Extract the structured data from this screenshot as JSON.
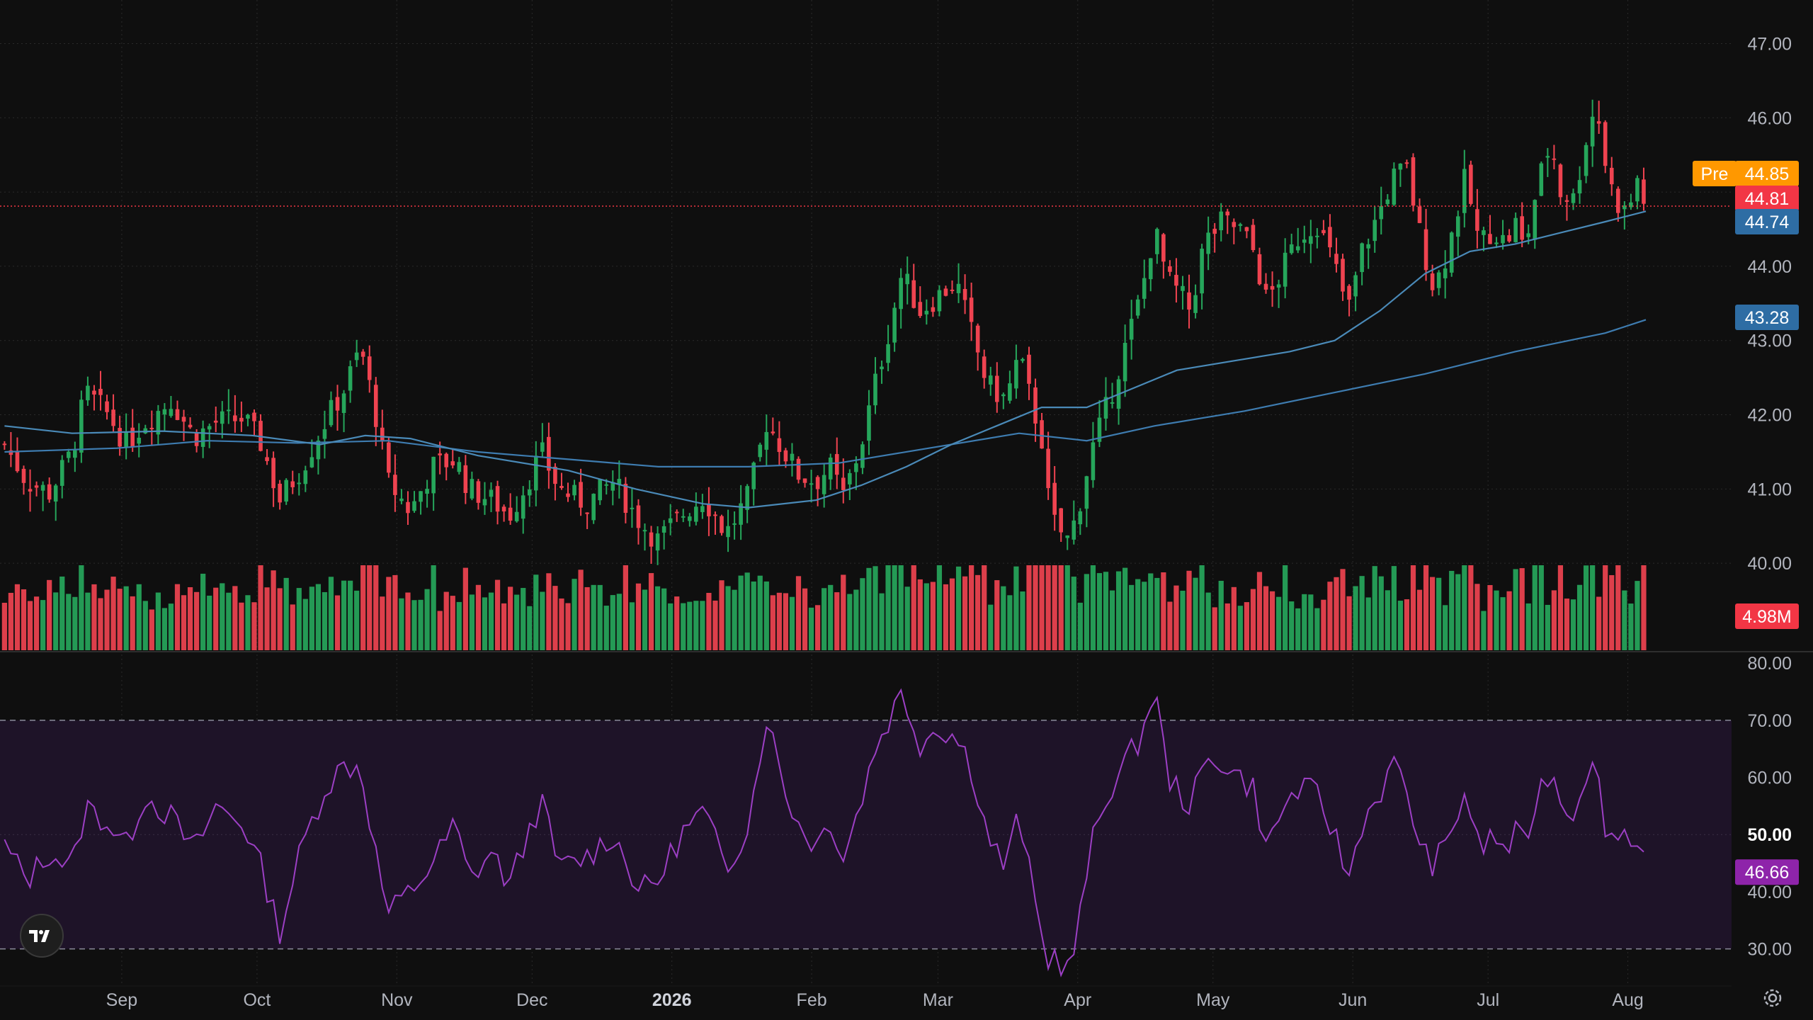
{
  "chart_data": {
    "type": "candlestick",
    "price_axis": {
      "ticks": [
        "47.00",
        "46.00",
        "45.00",
        "44.00",
        "43.00",
        "42.00",
        "41.00",
        "40.00"
      ],
      "range": [
        39.0,
        47.3
      ]
    },
    "time_axis": {
      "labels": [
        {
          "text": "Sep",
          "day": 11,
          "bold": false
        },
        {
          "text": "Oct",
          "day": 41,
          "bold": false
        },
        {
          "text": "Nov",
          "day": 72,
          "bold": false
        },
        {
          "text": "Dec",
          "day": 102,
          "bold": false
        },
        {
          "text": "2026",
          "day": 133,
          "bold": true
        },
        {
          "text": "Feb",
          "day": 164,
          "bold": false
        },
        {
          "text": "Mar",
          "day": 192,
          "bold": false
        },
        {
          "text": "Apr",
          "day": 223,
          "bold": false
        },
        {
          "text": "May",
          "day": 253,
          "bold": false
        },
        {
          "text": "Jun",
          "day": 284,
          "bold": false
        },
        {
          "text": "Jul",
          "day": 314,
          "bold": false
        },
        {
          "text": "Aug",
          "day": 345,
          "bold": false
        }
      ],
      "day_range": [
        -16,
        368
      ]
    },
    "price_path": [
      [
        -15,
        41.6
      ],
      [
        -10,
        41.1
      ],
      [
        -5,
        40.95
      ],
      [
        0,
        41.5
      ],
      [
        3,
        42.3
      ],
      [
        8,
        42.0
      ],
      [
        12,
        41.6
      ],
      [
        16,
        41.9
      ],
      [
        22,
        42.2
      ],
      [
        27,
        41.7
      ],
      [
        32,
        41.9
      ],
      [
        38,
        41.95
      ],
      [
        42,
        41.6
      ],
      [
        46,
        40.85
      ],
      [
        51,
        41.3
      ],
      [
        56,
        41.9
      ],
      [
        60,
        42.3
      ],
      [
        64,
        42.9
      ],
      [
        67,
        42.1
      ],
      [
        70,
        41.1
      ],
      [
        75,
        40.7
      ],
      [
        80,
        41.3
      ],
      [
        85,
        41.4
      ],
      [
        88,
        41.0
      ],
      [
        93,
        40.85
      ],
      [
        97,
        40.65
      ],
      [
        101,
        41.1
      ],
      [
        104,
        41.5
      ],
      [
        108,
        41.0
      ],
      [
        114,
        40.8
      ],
      [
        120,
        41.1
      ],
      [
        126,
        40.55
      ],
      [
        130,
        40.3
      ],
      [
        135,
        40.65
      ],
      [
        140,
        40.9
      ],
      [
        145,
        40.4
      ],
      [
        150,
        40.9
      ],
      [
        154,
        41.9
      ],
      [
        158,
        41.5
      ],
      [
        161,
        41.2
      ],
      [
        165,
        41.1
      ],
      [
        168,
        41.3
      ],
      [
        171,
        40.9
      ],
      [
        175,
        41.6
      ],
      [
        178,
        42.4
      ],
      [
        181,
        43.1
      ],
      [
        184,
        43.9
      ],
      [
        188,
        43.4
      ],
      [
        192,
        43.6
      ],
      [
        196,
        43.8
      ],
      [
        199,
        43.2
      ],
      [
        203,
        42.4
      ],
      [
        207,
        42.2
      ],
      [
        210,
        42.8
      ],
      [
        213,
        42.1
      ],
      [
        215,
        41.7
      ],
      [
        216,
        41.0
      ],
      [
        218,
        40.5
      ],
      [
        221,
        40.3
      ],
      [
        223,
        40.7
      ],
      [
        226,
        41.5
      ],
      [
        230,
        42.2
      ],
      [
        234,
        43.0
      ],
      [
        237,
        43.6
      ],
      [
        240,
        44.5
      ],
      [
        243,
        43.8
      ],
      [
        246,
        43.6
      ],
      [
        248,
        43.4
      ],
      [
        251,
        44.3
      ],
      [
        255,
        44.6
      ],
      [
        259,
        44.5
      ],
      [
        262,
        44.2
      ],
      [
        265,
        43.5
      ],
      [
        268,
        43.9
      ],
      [
        272,
        44.4
      ],
      [
        276,
        44.6
      ],
      [
        280,
        44.0
      ],
      [
        283,
        43.4
      ],
      [
        286,
        44.2
      ],
      [
        289,
        44.6
      ],
      [
        293,
        45.2
      ],
      [
        296,
        45.3
      ],
      [
        299,
        44.4
      ],
      [
        302,
        43.7
      ],
      [
        305,
        44.2
      ],
      [
        309,
        45.2
      ],
      [
        312,
        44.3
      ],
      [
        315,
        44.5
      ],
      [
        318,
        44.3
      ],
      [
        320,
        44.6
      ],
      [
        322,
        44.2
      ],
      [
        325,
        45.1
      ],
      [
        328,
        45.7
      ],
      [
        330,
        45.0
      ],
      [
        333,
        44.9
      ],
      [
        336,
        45.8
      ],
      [
        338,
        46.2
      ],
      [
        340,
        45.4
      ],
      [
        342,
        44.9
      ],
      [
        345,
        44.7
      ],
      [
        347,
        45.2
      ],
      [
        349,
        44.8
      ]
    ],
    "sma_50_path": [
      [
        -15,
        41.85
      ],
      [
        0,
        41.75
      ],
      [
        20,
        41.78
      ],
      [
        40,
        41.72
      ],
      [
        55,
        41.6
      ],
      [
        65,
        41.72
      ],
      [
        75,
        41.68
      ],
      [
        90,
        41.45
      ],
      [
        110,
        41.25
      ],
      [
        125,
        41.0
      ],
      [
        140,
        40.8
      ],
      [
        150,
        40.75
      ],
      [
        165,
        40.85
      ],
      [
        175,
        41.05
      ],
      [
        185,
        41.3
      ],
      [
        195,
        41.6
      ],
      [
        205,
        41.85
      ],
      [
        215,
        42.1
      ],
      [
        225,
        42.1
      ],
      [
        235,
        42.35
      ],
      [
        245,
        42.6
      ],
      [
        260,
        42.75
      ],
      [
        270,
        42.85
      ],
      [
        280,
        43.0
      ],
      [
        290,
        43.4
      ],
      [
        300,
        43.9
      ],
      [
        310,
        44.2
      ],
      [
        320,
        44.3
      ],
      [
        330,
        44.45
      ],
      [
        340,
        44.6
      ],
      [
        349,
        44.74
      ]
    ],
    "sma_200_path": [
      [
        -15,
        41.5
      ],
      [
        10,
        41.55
      ],
      [
        30,
        41.65
      ],
      [
        50,
        41.62
      ],
      [
        70,
        41.65
      ],
      [
        90,
        41.5
      ],
      [
        110,
        41.4
      ],
      [
        130,
        41.3
      ],
      [
        150,
        41.3
      ],
      [
        170,
        41.35
      ],
      [
        190,
        41.55
      ],
      [
        210,
        41.75
      ],
      [
        225,
        41.65
      ],
      [
        240,
        41.85
      ],
      [
        260,
        42.05
      ],
      [
        280,
        42.3
      ],
      [
        300,
        42.55
      ],
      [
        320,
        42.85
      ],
      [
        340,
        43.1
      ],
      [
        349,
        43.28
      ]
    ],
    "rsi": {
      "ticks": [
        "80.00",
        "70.00",
        "60.00",
        "50.00",
        "40.00",
        "30.00"
      ],
      "range": [
        25,
        82
      ],
      "upper_band": 70,
      "lower_band": 30,
      "path": [
        [
          -15,
          48
        ],
        [
          -10,
          42
        ],
        [
          -5,
          47
        ],
        [
          0,
          44
        ],
        [
          3,
          55
        ],
        [
          8,
          52
        ],
        [
          12,
          48
        ],
        [
          16,
          57
        ],
        [
          22,
          53
        ],
        [
          27,
          47
        ],
        [
          32,
          55
        ],
        [
          38,
          52
        ],
        [
          42,
          44
        ],
        [
          46,
          33
        ],
        [
          51,
          48
        ],
        [
          56,
          58
        ],
        [
          60,
          62
        ],
        [
          64,
          62
        ],
        [
          67,
          48
        ],
        [
          70,
          36
        ],
        [
          75,
          40
        ],
        [
          80,
          45
        ],
        [
          85,
          52
        ],
        [
          88,
          42
        ],
        [
          93,
          47
        ],
        [
          97,
          41
        ],
        [
          101,
          50
        ],
        [
          104,
          56
        ],
        [
          108,
          44
        ],
        [
          114,
          46
        ],
        [
          120,
          50
        ],
        [
          126,
          40
        ],
        [
          130,
          42
        ],
        [
          135,
          50
        ],
        [
          140,
          54
        ],
        [
          145,
          44
        ],
        [
          150,
          52
        ],
        [
          154,
          71
        ],
        [
          158,
          58
        ],
        [
          161,
          52
        ],
        [
          165,
          48
        ],
        [
          168,
          53
        ],
        [
          171,
          46
        ],
        [
          175,
          56
        ],
        [
          178,
          65
        ],
        [
          181,
          70
        ],
        [
          184,
          75
        ],
        [
          188,
          66
        ],
        [
          192,
          69
        ],
        [
          196,
          67
        ],
        [
          199,
          63
        ],
        [
          203,
          50
        ],
        [
          207,
          44
        ],
        [
          210,
          54
        ],
        [
          213,
          40
        ],
        [
          215,
          32
        ],
        [
          216,
          28
        ],
        [
          218,
          29
        ],
        [
          221,
          26
        ],
        [
          223,
          33
        ],
        [
          226,
          48
        ],
        [
          230,
          58
        ],
        [
          234,
          63
        ],
        [
          237,
          67
        ],
        [
          240,
          76
        ],
        [
          243,
          60
        ],
        [
          246,
          57
        ],
        [
          248,
          55
        ],
        [
          251,
          62
        ],
        [
          255,
          63
        ],
        [
          259,
          60
        ],
        [
          262,
          58
        ],
        [
          265,
          47
        ],
        [
          268,
          54
        ],
        [
          272,
          58
        ],
        [
          276,
          57
        ],
        [
          280,
          50
        ],
        [
          283,
          42
        ],
        [
          286,
          52
        ],
        [
          289,
          56
        ],
        [
          293,
          62
        ],
        [
          296,
          58
        ],
        [
          299,
          47
        ],
        [
          302,
          45
        ],
        [
          305,
          48
        ],
        [
          309,
          58
        ],
        [
          312,
          47
        ],
        [
          315,
          50
        ],
        [
          318,
          47
        ],
        [
          320,
          50
        ],
        [
          322,
          48
        ],
        [
          325,
          57
        ],
        [
          328,
          62
        ],
        [
          330,
          56
        ],
        [
          333,
          54
        ],
        [
          336,
          62
        ],
        [
          338,
          61
        ],
        [
          340,
          52
        ],
        [
          342,
          49
        ],
        [
          345,
          51
        ],
        [
          347,
          48
        ],
        [
          349,
          46.66
        ]
      ]
    },
    "volume": {
      "scale_max": 20,
      "unit": "M"
    },
    "price_badges": [
      {
        "label": "Pre",
        "value": "44.85",
        "price": 44.85,
        "color": "#ff9800"
      },
      {
        "value": "44.81",
        "price": 44.81,
        "color": "#f23645"
      },
      {
        "value": "44.74",
        "price": 44.74,
        "color": "#2962ff_alt"
      },
      {
        "value": "43.28",
        "price": 43.28,
        "color": "#2e6da4"
      }
    ],
    "volume_badge": {
      "value": "4.98M",
      "color": "#f23645"
    },
    "rsi_badges": [
      {
        "value": "50.00",
        "level": 50,
        "kind": "plain"
      },
      {
        "value": "46.66",
        "level": 46.66,
        "kind": "purple"
      }
    ],
    "colors": {
      "background": "#0f0f0f",
      "up": "#26a65b",
      "down": "#ef4350",
      "sma50": "#4a8ab8",
      "sma200": "#3e7cb0",
      "rsi_line": "#9c3fc4",
      "rsi_band": "#1e1328",
      "grid": "#2a2a2a",
      "dotted_price": "#f23645"
    }
  },
  "icons": {
    "logo": "tradingview-logo-icon",
    "settings": "gear-icon"
  }
}
